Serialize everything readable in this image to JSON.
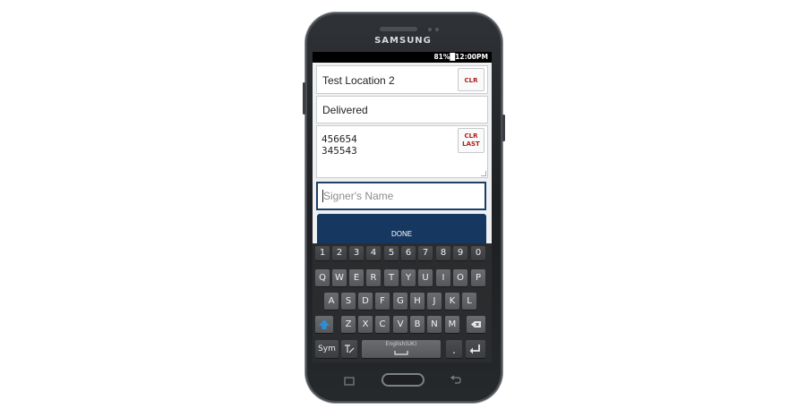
{
  "device": {
    "brand": "SAMSUNG"
  },
  "status_bar": {
    "text": "81%█12:00PM"
  },
  "form": {
    "location": {
      "value": "Test Location 2",
      "clear_label": "CLR"
    },
    "status": {
      "value": "Delivered"
    },
    "scans": {
      "lines": [
        "456654",
        "345543"
      ],
      "clear_last_label_1": "CLR",
      "clear_last_label_2": "LAST"
    },
    "signer": {
      "placeholder": "Signer's Name"
    },
    "done_label": "DONE"
  },
  "keyboard": {
    "number_row": [
      "1",
      "2",
      "3",
      "4",
      "5",
      "6",
      "7",
      "8",
      "9",
      "0"
    ],
    "row1": [
      "Q",
      "W",
      "E",
      "R",
      "T",
      "Y",
      "U",
      "I",
      "O",
      "P"
    ],
    "row2": [
      "A",
      "S",
      "D",
      "F",
      "G",
      "H",
      "J",
      "K",
      "L"
    ],
    "row3": [
      "Z",
      "X",
      "C",
      "V",
      "B",
      "N",
      "M"
    ],
    "sym_label": "Sym",
    "space_label": "English(UK)",
    "period_label": ".",
    "icons": {
      "shift": "shift-icon",
      "backspace": "backspace-icon",
      "enter": "enter-icon",
      "handwriting": "handwriting-icon"
    },
    "accent": "#2c8fd6"
  },
  "colors": {
    "done_button": "#163760",
    "clear_text": "#b01d1d"
  }
}
